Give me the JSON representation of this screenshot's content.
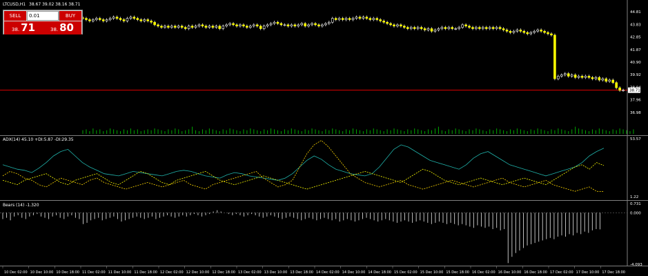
{
  "header": {
    "symbol": "LTCUSD,H1",
    "ohlc": "38.67 39.02 38.16 38.71"
  },
  "trade_panel": {
    "sell_label": "SELL",
    "buy_label": "BUY",
    "lot": "0.01",
    "sell_price_small": "38.",
    "sell_price_big": "71",
    "buy_price_small": "38.",
    "buy_price_big": "80"
  },
  "current_price_label": "38.71",
  "adx_title": "ADX(14) 45.10 +DI:5.87 -DI:29.35",
  "bears_title": "Bears (14) -1.320",
  "colors": {
    "bull": "#ffff00",
    "bear": "#ffffff",
    "volume": "#00aa00",
    "adx": "#20b2aa",
    "plus_di": "#ffd700",
    "minus_di": "#ffff00",
    "bears": "#c0c0c0",
    "price_line": "#ff0000"
  },
  "chart_data": [
    {
      "type": "candlestick",
      "title": "LTCUSD,H1 38.67 39.02 38.16 38.71",
      "y_ticks": [
        "44.81",
        "43.83",
        "42.85",
        "41.87",
        "40.90",
        "39.92",
        "38.94",
        "38.71",
        "37.96",
        "36.98"
      ],
      "x_ticks": [
        "10 Dec 02:00",
        "10 Dec 10:00",
        "10 Dec 18:00",
        "11 Dec 02:00",
        "11 Dec 10:00",
        "11 Dec 18:00",
        "12 Dec 02:00",
        "12 Dec 10:00",
        "12 Dec 18:00",
        "13 Dec 02:00",
        "13 Dec 10:00",
        "13 Dec 18:00",
        "14 Dec 02:00",
        "14 Dec 10:00",
        "14 Dec 18:00",
        "15 Dec 02:00",
        "15 Dec 10:00",
        "15 Dec 18:00",
        "16 Dec 02:00",
        "16 Dec 10:00",
        "16 Dec 18:00",
        "17 Dec 02:00",
        "17 Dec 10:00",
        "17 Dec 18:00"
      ],
      "ylim": [
        36.6,
        45.3
      ],
      "close": [
        44.3,
        44.2,
        44.1,
        44.2,
        44.3,
        44.2,
        44.1,
        44.2,
        44.3,
        44.4,
        44.3,
        44.2,
        44.1,
        44.3,
        44.4,
        44.3,
        44.2,
        44.1,
        44.2,
        44.1,
        44.0,
        43.8,
        43.7,
        43.6,
        43.7,
        43.6,
        43.7,
        43.6,
        43.7,
        43.6,
        43.5,
        43.7,
        43.6,
        43.7,
        43.8,
        43.7,
        43.6,
        43.7,
        43.6,
        43.7,
        43.5,
        43.7,
        43.8,
        43.9,
        43.8,
        43.7,
        43.8,
        43.7,
        43.6,
        43.7,
        43.8,
        43.7,
        43.5,
        43.7,
        43.8,
        43.9,
        44.0,
        43.9,
        43.8,
        43.8,
        43.7,
        43.8,
        43.7,
        43.8,
        43.9,
        43.7,
        43.8,
        43.9,
        43.8,
        43.7,
        43.8,
        43.9,
        44.0,
        44.3,
        44.2,
        44.3,
        44.2,
        44.3,
        44.2,
        44.3,
        44.4,
        44.3,
        44.4,
        44.3,
        44.2,
        44.3,
        44.2,
        44.1,
        44.0,
        43.9,
        43.8,
        43.7,
        43.8,
        43.7,
        43.6,
        43.5,
        43.6,
        43.5,
        43.6,
        43.5,
        43.4,
        43.5,
        43.3,
        43.4,
        43.5,
        43.6,
        43.5,
        43.6,
        43.5,
        43.5,
        43.6,
        43.8,
        43.7,
        43.6,
        43.5,
        43.6,
        43.5,
        43.6,
        43.5,
        43.6,
        43.5,
        43.6,
        43.5,
        43.4,
        43.3,
        43.2,
        43.3,
        43.4,
        43.3,
        43.2,
        43.1,
        43.2,
        43.3,
        43.4,
        43.3,
        43.2,
        43.1,
        43.0,
        39.6,
        39.8,
        39.9,
        40.0,
        39.8,
        39.9,
        39.7,
        39.8,
        39.7,
        39.8,
        39.7,
        39.6,
        39.7,
        39.5,
        39.6,
        39.4,
        39.5,
        39.3,
        38.9,
        38.7,
        38.71
      ],
      "volume": [
        4,
        5,
        3,
        6,
        4,
        5,
        3,
        4,
        6,
        5,
        4,
        3,
        5,
        4,
        6,
        4,
        5,
        3,
        4,
        5,
        4,
        6,
        5,
        4,
        3,
        5,
        4,
        6,
        5,
        3,
        4,
        5,
        8,
        4,
        3,
        5,
        4,
        6,
        5,
        4,
        3,
        5,
        4,
        6,
        5,
        4,
        3,
        5,
        4,
        6,
        5,
        4,
        3,
        5,
        4,
        6,
        5,
        4,
        3,
        5,
        4,
        6,
        5,
        4,
        3,
        5,
        4,
        6,
        5,
        4,
        3,
        5,
        4,
        6,
        5,
        4,
        3,
        5,
        4,
        6,
        5,
        4,
        3,
        5,
        4,
        6,
        5,
        4,
        3,
        5,
        4,
        6,
        5,
        4,
        3,
        5,
        4,
        6,
        5,
        4,
        3,
        5,
        4,
        6,
        8,
        4,
        3,
        5,
        4,
        6,
        5,
        4,
        3,
        5,
        4,
        6,
        5,
        4,
        3,
        5,
        4,
        6,
        5,
        4,
        3,
        5,
        4,
        6,
        5,
        4,
        3,
        5,
        4,
        6,
        5,
        4,
        3,
        5,
        4,
        6,
        5,
        4,
        3,
        5,
        8,
        6,
        5,
        4,
        3,
        5,
        4,
        6,
        5,
        4,
        3,
        5,
        4,
        6,
        5,
        4,
        3,
        5
      ]
    },
    {
      "type": "line",
      "title": "ADX(14) 45.10 +DI:5.87 -DI:29.35",
      "y_ticks": [
        "53.57",
        "1.22"
      ],
      "ylim": [
        1.22,
        53.57
      ],
      "series": [
        {
          "name": "ADX",
          "values": [
            30,
            28,
            26,
            25,
            23,
            27,
            32,
            38,
            42,
            44,
            38,
            32,
            28,
            25,
            22,
            21,
            20,
            22,
            24,
            23,
            22,
            21,
            20,
            22,
            24,
            25,
            24,
            22,
            20,
            19,
            18,
            21,
            23,
            22,
            20,
            19,
            18,
            17,
            16,
            18,
            22,
            28,
            34,
            38,
            35,
            30,
            26,
            24,
            22,
            21,
            20,
            22,
            28,
            36,
            44,
            48,
            46,
            42,
            38,
            34,
            32,
            30,
            28,
            26,
            30,
            36,
            40,
            42,
            38,
            34,
            30,
            28,
            26,
            24,
            22,
            20,
            22,
            24,
            26,
            28,
            32,
            38,
            42,
            45
          ]
        },
        {
          "name": "+DI",
          "values": [
            20,
            24,
            22,
            18,
            16,
            12,
            10,
            14,
            18,
            16,
            14,
            12,
            16,
            18,
            14,
            12,
            10,
            8,
            10,
            12,
            14,
            12,
            10,
            12,
            14,
            16,
            12,
            10,
            8,
            12,
            14,
            16,
            18,
            20,
            22,
            24,
            18,
            14,
            10,
            12,
            16,
            28,
            40,
            48,
            52,
            46,
            38,
            30,
            22,
            18,
            14,
            12,
            10,
            12,
            14,
            16,
            12,
            10,
            8,
            10,
            12,
            14,
            16,
            14,
            12,
            10,
            12,
            14,
            16,
            18,
            14,
            12,
            10,
            12,
            14,
            16,
            12,
            10,
            8,
            6,
            8,
            10,
            6,
            5.87
          ]
        },
        {
          "name": "-DI",
          "values": [
            16,
            14,
            12,
            16,
            18,
            20,
            22,
            18,
            14,
            12,
            16,
            18,
            20,
            22,
            18,
            14,
            12,
            16,
            20,
            24,
            22,
            18,
            14,
            12,
            16,
            18,
            20,
            22,
            24,
            20,
            16,
            14,
            12,
            14,
            16,
            18,
            20,
            18,
            16,
            14,
            12,
            10,
            8,
            10,
            12,
            14,
            16,
            18,
            20,
            22,
            24,
            22,
            20,
            18,
            16,
            14,
            18,
            22,
            26,
            24,
            20,
            16,
            14,
            12,
            14,
            16,
            18,
            16,
            14,
            12,
            14,
            16,
            18,
            16,
            14,
            12,
            16,
            20,
            24,
            28,
            30,
            26,
            32,
            29.35
          ]
        }
      ]
    },
    {
      "type": "bar",
      "title": "Bears (14) -1.320",
      "y_ticks": [
        "0.731",
        "0.000",
        "-4.093"
      ],
      "ylim": [
        -4.093,
        0.731
      ],
      "values": [
        -0.5,
        -0.4,
        -0.6,
        -0.3,
        -0.2,
        -0.4,
        -0.5,
        -0.3,
        -0.2,
        -0.1,
        -0.3,
        -0.4,
        -0.5,
        -0.3,
        -0.2,
        -0.4,
        -0.5,
        -0.3,
        -0.2,
        -0.4,
        -0.5,
        -0.9,
        -0.8,
        -0.6,
        -0.5,
        -0.4,
        -0.6,
        -0.5,
        -0.4,
        -0.3,
        -0.5,
        -0.7,
        -0.6,
        -0.5,
        -0.4,
        -0.3,
        -0.4,
        -0.5,
        -0.4,
        -0.3,
        -0.5,
        -0.4,
        -0.3,
        -0.2,
        -0.3,
        -0.4,
        -0.3,
        -0.2,
        -0.3,
        -0.2,
        -0.1,
        -0.2,
        -0.3,
        -0.2,
        -0.1,
        0.1,
        0.2,
        0.1,
        0.0,
        -0.1,
        -0.2,
        -0.1,
        -0.2,
        -0.3,
        -0.2,
        -0.1,
        -0.2,
        -0.3,
        -0.4,
        -0.3,
        -0.2,
        -0.3,
        -0.4,
        -0.5,
        -0.4,
        -0.3,
        -0.4,
        -0.5,
        -0.6,
        -0.5,
        -0.4,
        -0.5,
        -0.6,
        -0.5,
        -0.4,
        -0.5,
        -0.6,
        -0.5,
        -0.7,
        -0.6,
        -0.5,
        -0.6,
        -0.7,
        -0.6,
        -0.5,
        -0.4,
        -0.5,
        -0.6,
        -0.7,
        -0.6,
        -0.5,
        -0.6,
        -0.7,
        -0.8,
        -0.7,
        -0.6,
        -0.7,
        -0.8,
        -0.7,
        -0.6,
        -0.7,
        -0.8,
        -0.9,
        -0.8,
        -0.7,
        -0.8,
        -0.9,
        -0.8,
        -0.9,
        -1.0,
        -0.9,
        -1.0,
        -1.1,
        -1.2,
        -1.0,
        -1.1,
        -1.2,
        -1.1,
        -1.3,
        -1.2,
        -1.4,
        -1.3,
        -4.0,
        -3.5,
        -3.2,
        -3.0,
        -2.8,
        -2.6,
        -2.5,
        -2.4,
        -2.3,
        -2.2,
        -2.1,
        -2.0,
        -2.1,
        -1.9,
        -1.8,
        -1.9,
        -1.7,
        -1.8,
        -1.6,
        -1.7,
        -1.5,
        -1.6,
        -1.4,
        -1.3,
        -1.32
      ]
    }
  ]
}
